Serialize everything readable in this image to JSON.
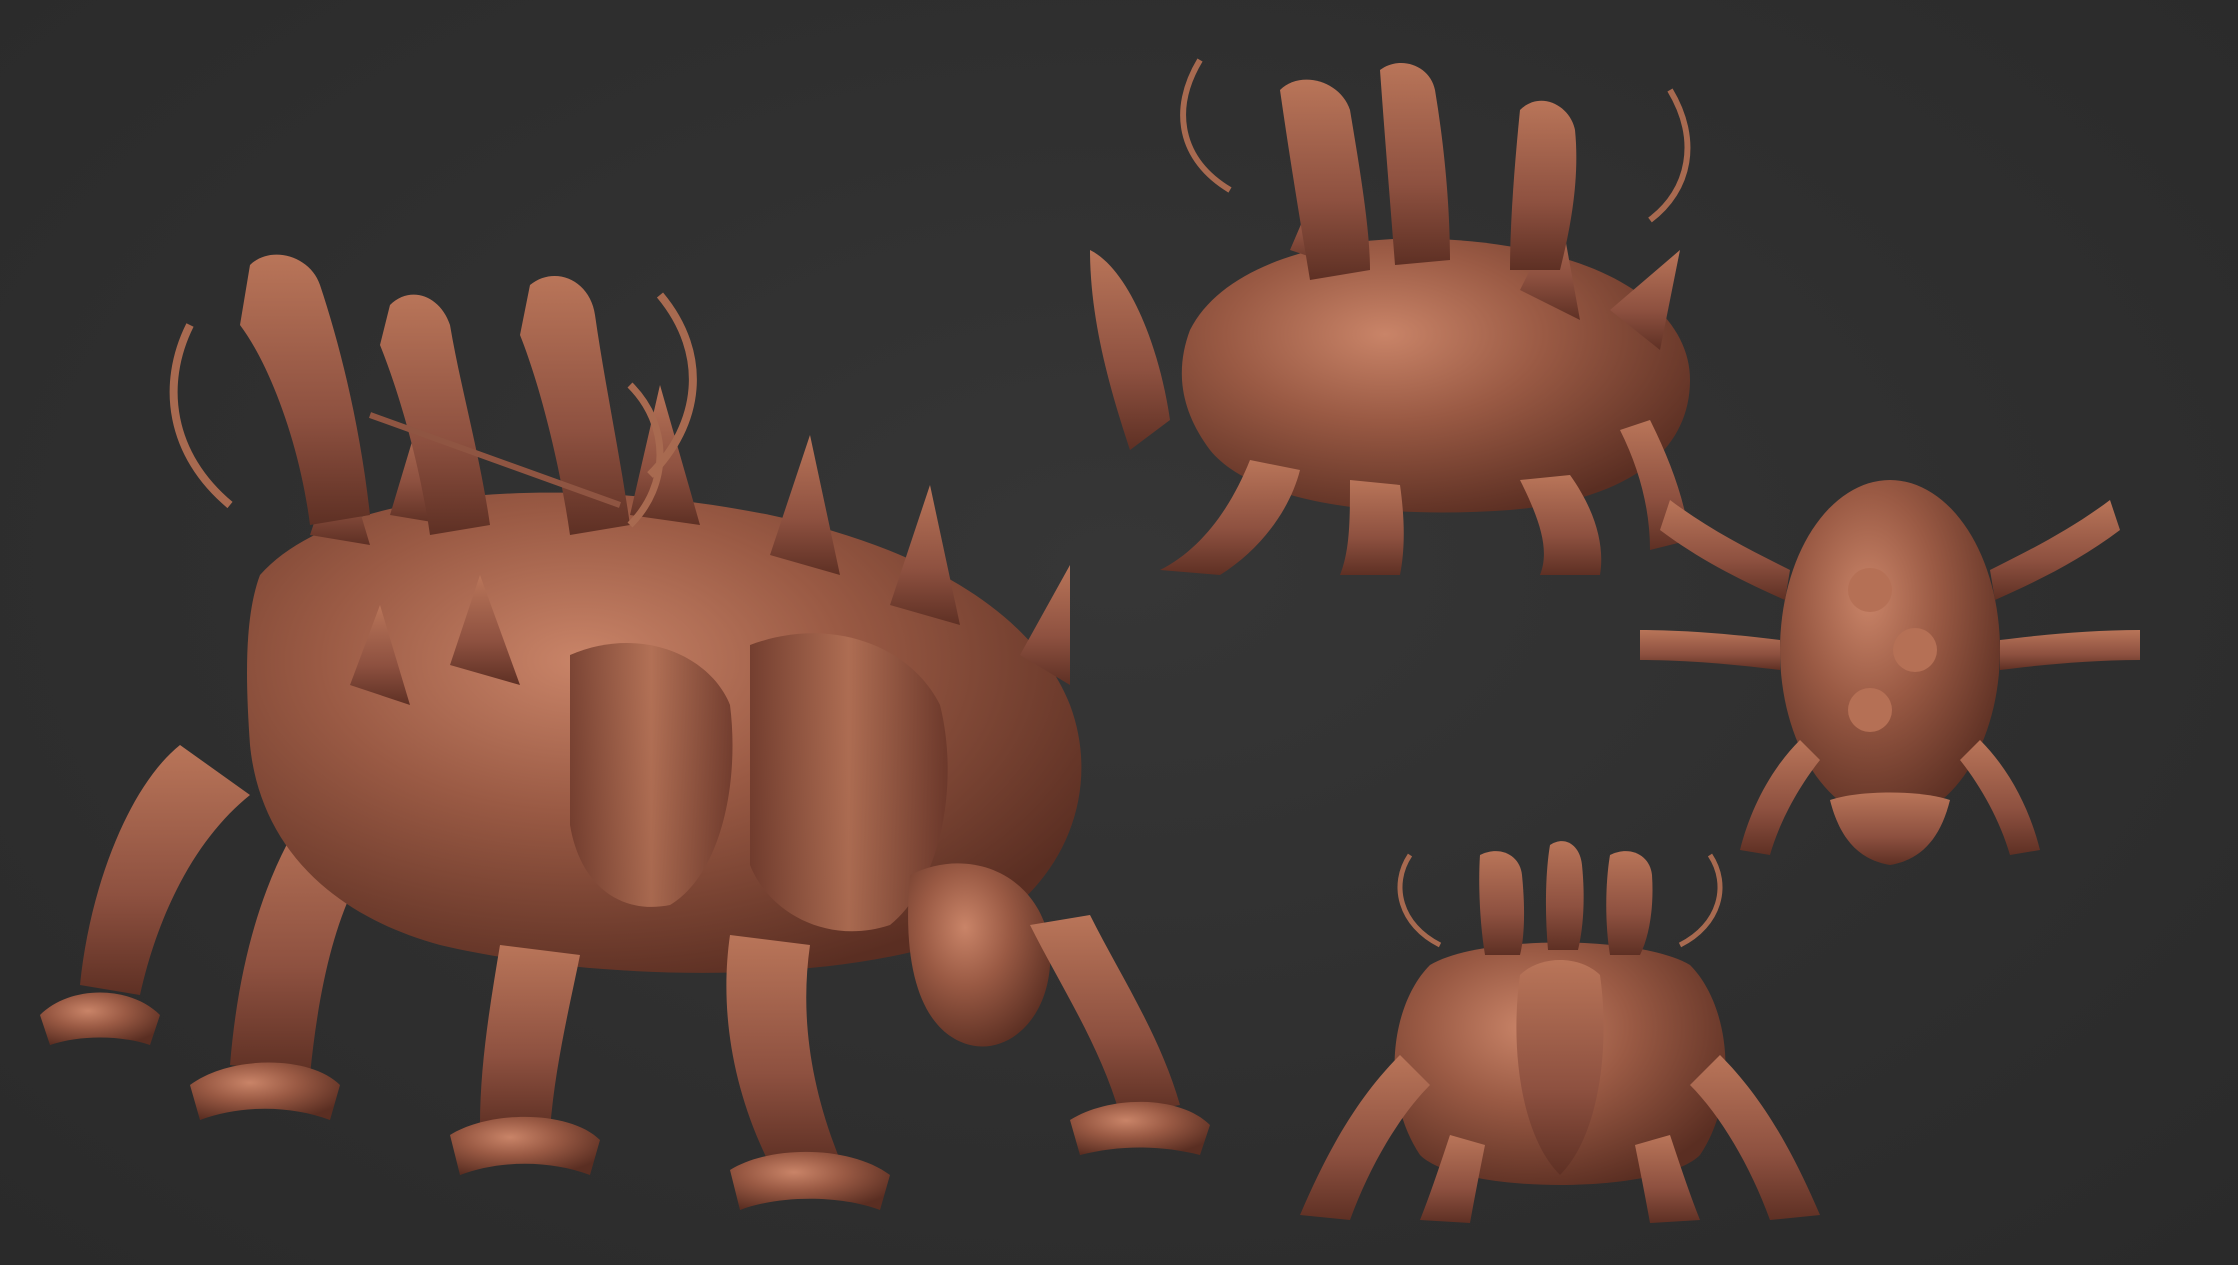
{
  "scene": {
    "background_color": "#2f2f2f",
    "material_color": "#9a5a44",
    "material_highlight": "#c98468",
    "material_shadow": "#5a2e22",
    "views": [
      {
        "name": "perspective-view",
        "subject": "beetle-mount-with-archer-riders"
      },
      {
        "name": "side-view",
        "subject": "beetle-mount-with-archer-riders"
      },
      {
        "name": "top-view",
        "subject": "beetle-mount-with-archer-riders"
      },
      {
        "name": "front-view",
        "subject": "beetle-mount-with-archer-riders"
      }
    ]
  }
}
